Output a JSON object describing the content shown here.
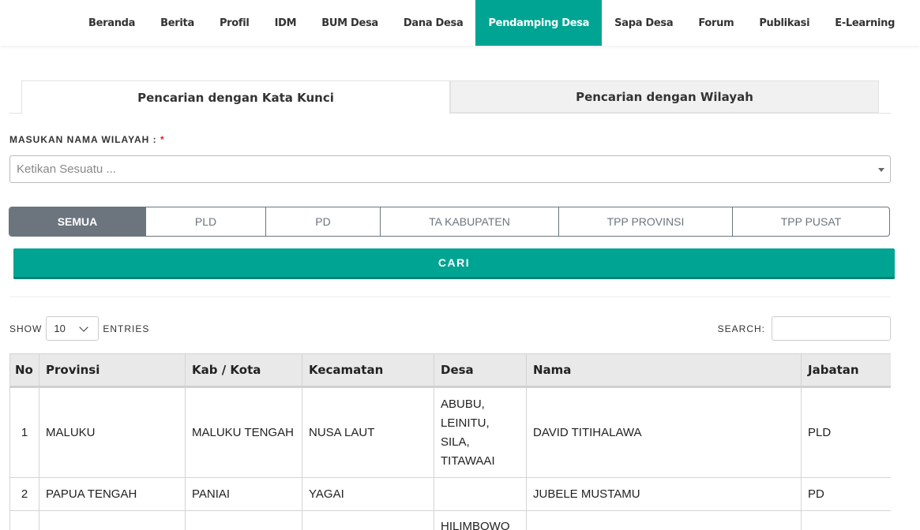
{
  "nav": {
    "items": [
      "Beranda",
      "Berita",
      "Profil",
      "IDM",
      "BUM Desa",
      "Dana Desa",
      "Pendamping Desa",
      "Sapa Desa",
      "Forum",
      "Publikasi",
      "E-Learning"
    ],
    "active": "Pendamping Desa"
  },
  "tabs": {
    "keyword": "Pencarian dengan Kata Kunci",
    "region": "Pencarian dengan Wilayah"
  },
  "form": {
    "label": "MASUKAN NAMA WILAYAH :",
    "required_mark": "*",
    "placeholder": "Ketikan Sesuatu ..."
  },
  "filters": {
    "options": [
      "SEMUA",
      "PLD",
      "PD",
      "TA KABUPATEN",
      "TPP PROVINSI",
      "TPP PUSAT"
    ],
    "selected": "SEMUA"
  },
  "search_button": "CARI",
  "datatable": {
    "show_label": "SHOW",
    "entries_value": "10",
    "entries_label": "ENTRIES",
    "search_label": "SEARCH:",
    "columns": [
      "No",
      "Provinsi",
      "Kab / Kota",
      "Kecamatan",
      "Desa",
      "Nama",
      "Jabatan"
    ],
    "rows": [
      {
        "no": "1",
        "provinsi": "MALUKU",
        "kab": "MALUKU TENGAH",
        "kecamatan": "NUSA LAUT",
        "desa": [
          "ABUBU,",
          "LEINITU,",
          "SILA,",
          "TITAWAAI"
        ],
        "nama": "DAVID TITIHALAWA",
        "jabatan": "PLD"
      },
      {
        "no": "2",
        "provinsi": "PAPUA TENGAH",
        "kab": "PANIAI",
        "kecamatan": "YAGAI",
        "desa": [],
        "nama": "JUBELE MUSTAMU",
        "jabatan": "PD"
      },
      {
        "no": "",
        "provinsi": "",
        "kab": "",
        "kecamatan": "",
        "desa": [
          "HILIMBOWO"
        ],
        "nama": "",
        "jabatan": ""
      }
    ]
  },
  "colors": {
    "accent": "#00a493",
    "segment_active": "#6c757d",
    "header_bg": "#e9e9e9"
  }
}
